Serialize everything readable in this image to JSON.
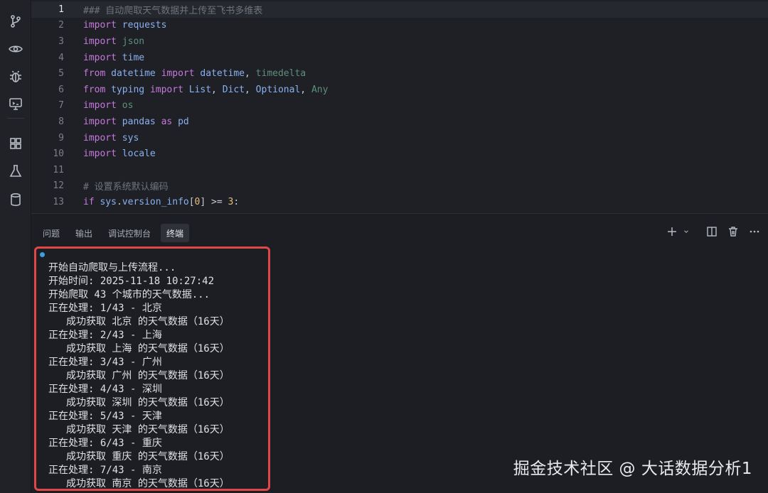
{
  "activity_bar": {
    "icons": [
      "source-control-icon",
      "eye-icon",
      "bug-icon",
      "remote-monitor-icon",
      "extensions-icon",
      "flask-icon",
      "database-icon"
    ]
  },
  "editor": {
    "lines": [
      {
        "num": "1",
        "tokens": [
          {
            "t": "### 自动爬取天气数据并上传至飞书多维表",
            "c": "cm"
          }
        ]
      },
      {
        "num": "2",
        "tokens": [
          {
            "t": "import",
            "c": "kw"
          },
          {
            "t": " requests",
            "c": "mod"
          }
        ]
      },
      {
        "num": "3",
        "tokens": [
          {
            "t": "import",
            "c": "kw"
          },
          {
            "t": " json",
            "c": "dim"
          }
        ]
      },
      {
        "num": "4",
        "tokens": [
          {
            "t": "import",
            "c": "kw"
          },
          {
            "t": " time",
            "c": "mod"
          }
        ]
      },
      {
        "num": "5",
        "tokens": [
          {
            "t": "from",
            "c": "kw"
          },
          {
            "t": " datetime ",
            "c": "mod"
          },
          {
            "t": "import",
            "c": "kw"
          },
          {
            "t": " datetime",
            "c": "mod"
          },
          {
            "t": ", ",
            "c": "pl"
          },
          {
            "t": "timedelta",
            "c": "dim"
          }
        ]
      },
      {
        "num": "6",
        "tokens": [
          {
            "t": "from",
            "c": "kw"
          },
          {
            "t": " typing ",
            "c": "mod"
          },
          {
            "t": "import",
            "c": "kw"
          },
          {
            "t": " List",
            "c": "mod"
          },
          {
            "t": ", ",
            "c": "pl"
          },
          {
            "t": "Dict",
            "c": "mod"
          },
          {
            "t": ", ",
            "c": "pl"
          },
          {
            "t": "Optional",
            "c": "mod"
          },
          {
            "t": ", ",
            "c": "pl"
          },
          {
            "t": "Any",
            "c": "dim"
          }
        ]
      },
      {
        "num": "7",
        "tokens": [
          {
            "t": "import",
            "c": "kw"
          },
          {
            "t": " os",
            "c": "dim"
          }
        ]
      },
      {
        "num": "8",
        "tokens": [
          {
            "t": "import",
            "c": "kw"
          },
          {
            "t": " pandas ",
            "c": "mod"
          },
          {
            "t": "as",
            "c": "kw"
          },
          {
            "t": " pd",
            "c": "mod"
          }
        ]
      },
      {
        "num": "9",
        "tokens": [
          {
            "t": "import",
            "c": "kw"
          },
          {
            "t": " sys",
            "c": "mod"
          }
        ]
      },
      {
        "num": "10",
        "tokens": [
          {
            "t": "import",
            "c": "kw"
          },
          {
            "t": " locale",
            "c": "mod"
          }
        ]
      },
      {
        "num": "11",
        "tokens": []
      },
      {
        "num": "12",
        "tokens": [
          {
            "t": "# 设置系统默认编码",
            "c": "cm"
          }
        ]
      },
      {
        "num": "13",
        "tokens": [
          {
            "t": "if",
            "c": "kw"
          },
          {
            "t": " sys",
            "c": "mod"
          },
          {
            "t": ".",
            "c": "pl"
          },
          {
            "t": "version_info",
            "c": "mod"
          },
          {
            "t": "[",
            "c": "pl"
          },
          {
            "t": "0",
            "c": "num"
          },
          {
            "t": "] >= ",
            "c": "pl"
          },
          {
            "t": "3",
            "c": "num"
          },
          {
            "t": ":",
            "c": "pl"
          }
        ]
      }
    ]
  },
  "panel": {
    "tabs": [
      {
        "label": "问题",
        "active": false
      },
      {
        "label": "输出",
        "active": false
      },
      {
        "label": "调试控制台",
        "active": false
      },
      {
        "label": "终端",
        "active": true
      }
    ],
    "toolbar": [
      "add-icon",
      "chevron-down-icon",
      "split-icon",
      "trash-icon",
      "more-icon"
    ]
  },
  "terminal": {
    "lines": [
      {
        "text": "开始自动爬取与上传流程...",
        "indent": false
      },
      {
        "text": "开始时间: 2025-11-18 10:27:42",
        "indent": false
      },
      {
        "text": "开始爬取 43 个城市的天气数据...",
        "indent": false
      },
      {
        "text": "正在处理: 1/43 - 北京",
        "indent": false
      },
      {
        "text": "成功获取 北京 的天气数据（16天）",
        "indent": true
      },
      {
        "text": "正在处理: 2/43 - 上海",
        "indent": false
      },
      {
        "text": "成功获取 上海 的天气数据（16天）",
        "indent": true
      },
      {
        "text": "正在处理: 3/43 - 广州",
        "indent": false
      },
      {
        "text": "成功获取 广州 的天气数据（16天）",
        "indent": true
      },
      {
        "text": "正在处理: 4/43 - 深圳",
        "indent": false
      },
      {
        "text": "成功获取 深圳 的天气数据（16天）",
        "indent": true
      },
      {
        "text": "正在处理: 5/43 - 天津",
        "indent": false
      },
      {
        "text": "成功获取 天津 的天气数据（16天）",
        "indent": true
      },
      {
        "text": "正在处理: 6/43 - 重庆",
        "indent": false
      },
      {
        "text": "成功获取 重庆 的天气数据（16天）",
        "indent": true
      },
      {
        "text": "正在处理: 7/43 - 南京",
        "indent": false
      },
      {
        "text": "成功获取 南京 的天气数据（16天）",
        "indent": true
      }
    ]
  },
  "watermark": "掘金技术社区 @ 大话数据分析1",
  "colors": {
    "highlight_box": "#e04848",
    "keyword": "#c679dd",
    "module": "#8ab0f0"
  }
}
